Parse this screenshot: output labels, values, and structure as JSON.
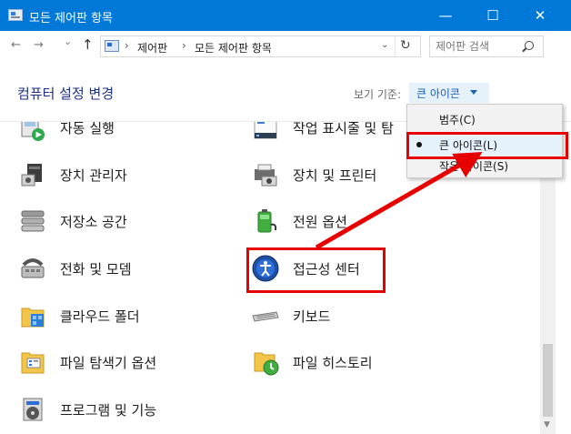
{
  "window": {
    "title": "모든 제어판 항목",
    "controls": {
      "minimize": "—",
      "maximize": "☐",
      "close": "✕"
    }
  },
  "address_bar": {
    "nav": {
      "back": "←",
      "forward": "→",
      "recent": "⌄",
      "up": "↑"
    },
    "breadcrumbs": [
      "제어판",
      "모든 제어판 항목"
    ],
    "separator": "›",
    "dropdown": "⌄",
    "refresh": "↻",
    "search_placeholder": "제어판 검색"
  },
  "header": {
    "title": "컴퓨터 설정 변경",
    "view_by_label": "보기 기준:",
    "view_by_value": "큰 아이콘"
  },
  "items": [
    {
      "label": "자동 실행",
      "icon": "autoplay-icon"
    },
    {
      "label": "작업 표시줄 및 탐",
      "icon": "taskbar-icon"
    },
    {
      "label": "장치 관리자",
      "icon": "device-manager-icon"
    },
    {
      "label": "장치 및 프린터",
      "icon": "printer-icon"
    },
    {
      "label": "저장소 공간",
      "icon": "storage-spaces-icon"
    },
    {
      "label": "전원 옵션",
      "icon": "battery-icon"
    },
    {
      "label": "전화 및 모뎀",
      "icon": "phone-modem-icon"
    },
    {
      "label": "접근성 센터",
      "icon": "ease-of-access-icon"
    },
    {
      "label": "클라우드 폴더",
      "icon": "cloud-folder-icon"
    },
    {
      "label": "키보드",
      "icon": "keyboard-icon"
    },
    {
      "label": "파일 탐색기 옵션",
      "icon": "folder-options-icon"
    },
    {
      "label": "파일 히스토리",
      "icon": "file-history-icon"
    },
    {
      "label": "프로그램 및 기능",
      "icon": "programs-features-icon"
    }
  ],
  "view_menu": {
    "options": [
      {
        "label": "범주(C)",
        "selected": false
      },
      {
        "label": "큰 아이콘(L)",
        "selected": true
      },
      {
        "label": "작은 아이콘(S)",
        "selected": false
      }
    ]
  },
  "colors": {
    "titlebar": "#0078d7",
    "title_text": "#1e3287",
    "link": "#1a5fb4",
    "highlight": "#e60000"
  },
  "scrollbar": {
    "up": "▲",
    "down": "▼"
  }
}
